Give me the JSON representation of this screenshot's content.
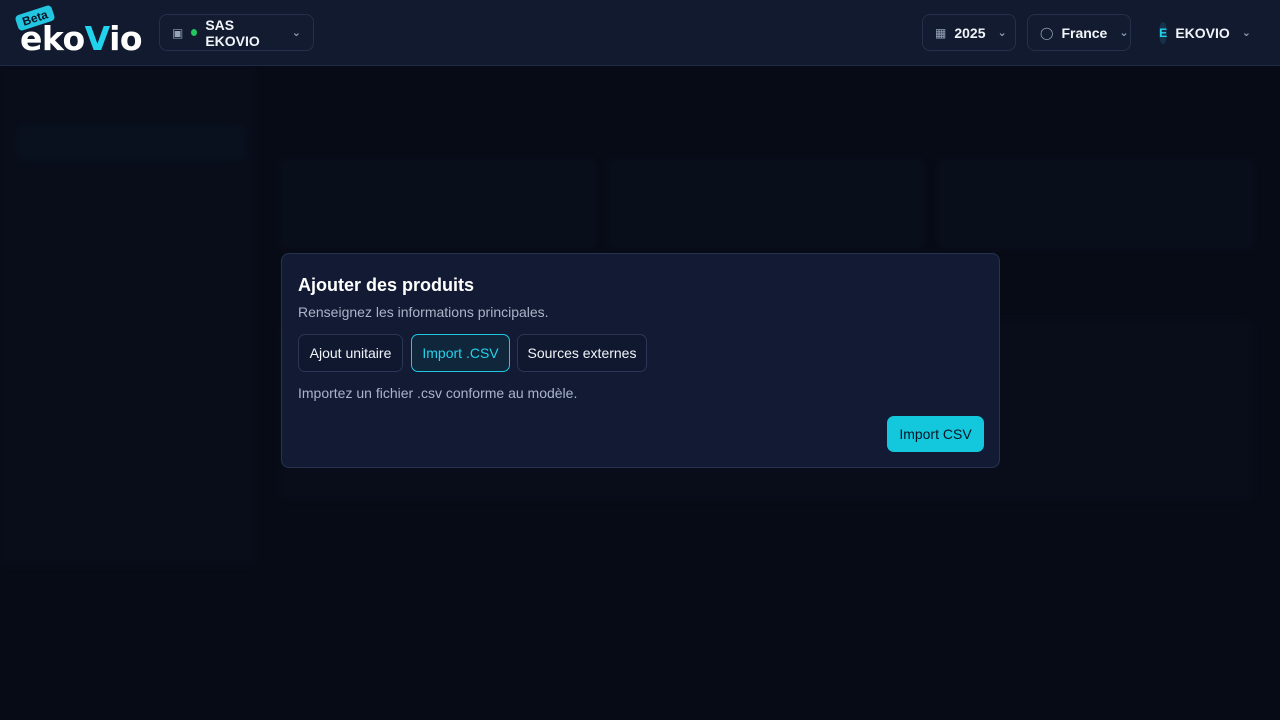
{
  "header": {
    "logo_text_a": "eko",
    "logo_text_b": "V",
    "logo_text_c": "io",
    "beta_badge": "Beta",
    "company": "SAS EKOVIO",
    "year": "2025",
    "country": "France",
    "user_initial": "E",
    "user_name": "EKOVIO"
  },
  "modal": {
    "title": "Ajouter des produits",
    "subtitle": "Renseignez les informations principales.",
    "tabs": [
      {
        "label": "Ajout unitaire"
      },
      {
        "label": "Import .CSV"
      },
      {
        "label": "Sources externes"
      }
    ],
    "active_tab": 1,
    "description": "Importez un fichier .csv conforme au modèle.",
    "primary_button": "Import CSV"
  },
  "colors": {
    "accent": "#22d3ee",
    "status_green": "#22c55e",
    "background": "#0a0f1c"
  }
}
